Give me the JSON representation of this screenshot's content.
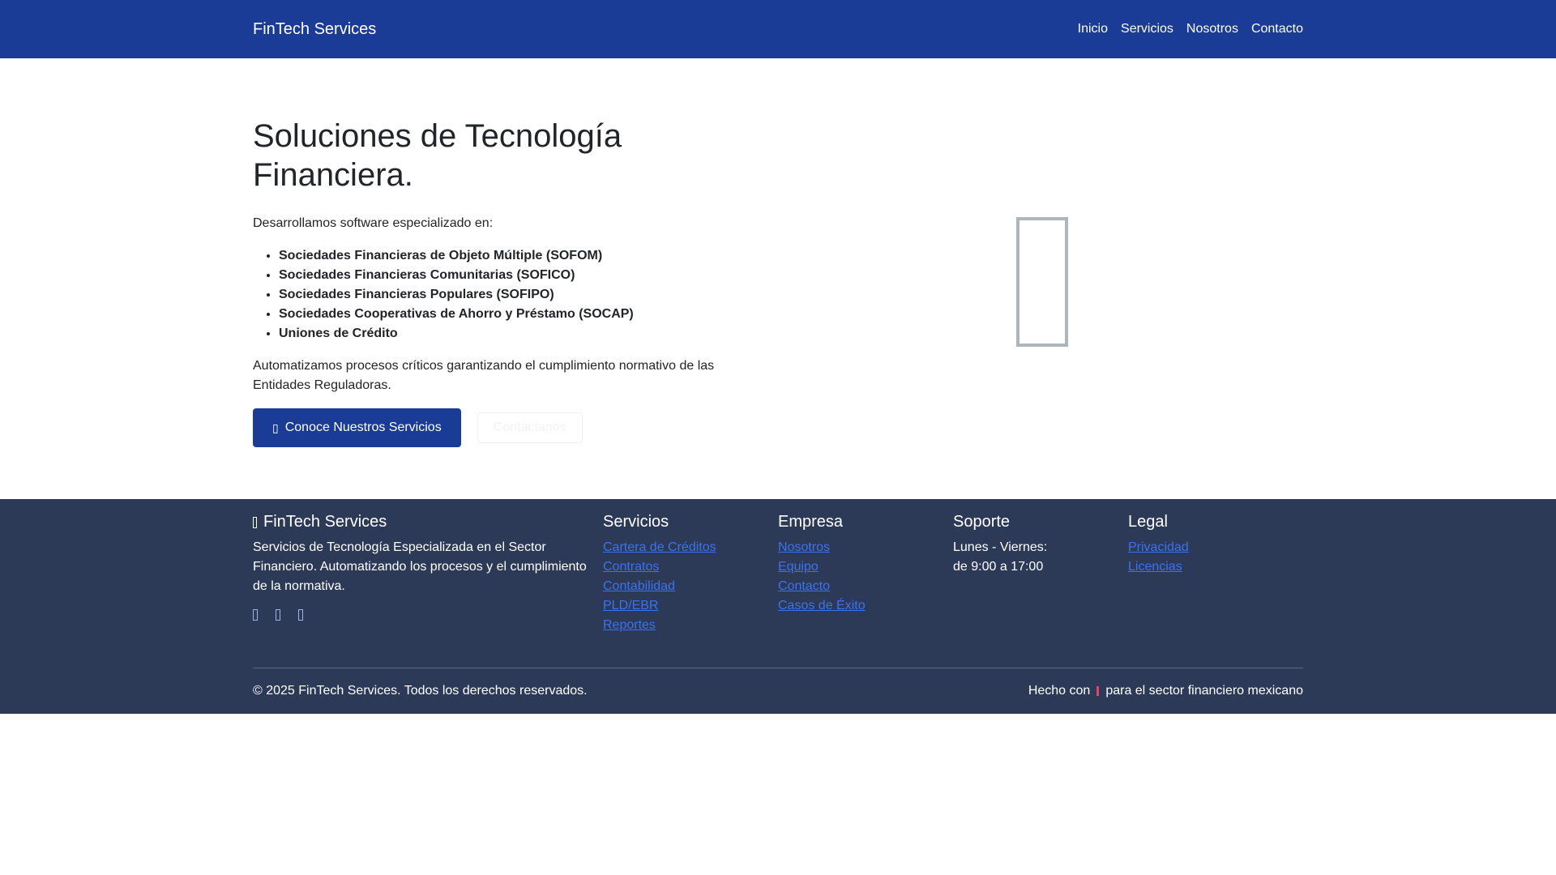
{
  "navbar": {
    "brand": "FinTech Services",
    "links": [
      "Inicio",
      "Servicios",
      "Nosotros",
      "Contacto"
    ]
  },
  "hero": {
    "title": "Soluciones de Tecnología Financiera.",
    "intro": "Desarrollamos software especializado en:",
    "bullets": [
      "Sociedades Financieras de Objeto Múltiple (SOFOM)",
      "Sociedades Financieras Comunitarias (SOFICO)",
      "Sociedades Financieras Populares (SOFIPO)",
      "Sociedades Cooperativas de Ahorro y Préstamo (SOCAP)",
      "Uniones de Crédito"
    ],
    "outro": "Automatizamos procesos críticos garantizando el cumplimiento normativo de las Entidades Reguladoras.",
    "primary_button": "Conoce Nuestros Servicios",
    "secondary_button": "Contáctanos",
    "illustration_icon": "building-icon"
  },
  "footer": {
    "brand": "FinTech Services",
    "about": "Servicios de Tecnología Especializada en el Sector Financiero. Automatizando los procesos y el cumplimiento de la normativa.",
    "social_icons": [
      "facebook-icon",
      "twitter-icon",
      "linkedin-icon"
    ],
    "columns": {
      "servicios": {
        "title": "Servicios",
        "links": [
          "Cartera de Créditos",
          "Contratos",
          "Contabilidad",
          "PLD/EBR",
          "Reportes"
        ]
      },
      "empresa": {
        "title": "Empresa",
        "links": [
          "Nosotros",
          "Equipo",
          "Contacto",
          "Casos de Éxito"
        ]
      },
      "soporte": {
        "title": "Soporte",
        "lines": [
          "Lunes - Viernes:",
          "de 9:00 a 17:00"
        ]
      },
      "legal": {
        "title": "Legal",
        "links": [
          "Privacidad",
          "Licencias"
        ]
      }
    },
    "copyright": "© 2025 FinTech Services. Todos los derechos reservados.",
    "made_with_prefix": "Hecho con",
    "made_with_suffix": "para el sector financiero mexicano"
  },
  "colors": {
    "primary": "#1a3c96",
    "footer_bg": "#2c3a58",
    "link": "#3a73f0",
    "heart": "#e0466a"
  }
}
